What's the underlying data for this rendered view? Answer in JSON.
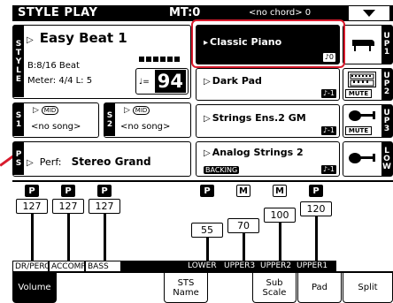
{
  "header": {
    "title": "STYLE PLAY",
    "mt": "MT:0",
    "chord": "<no chord> 0"
  },
  "style": {
    "tab_letters": [
      "S",
      "T",
      "Y",
      "L",
      "E"
    ],
    "name": "Easy Beat 1",
    "beat": "B:8/16 Beat",
    "meter": "Meter:  4/4  L: 5",
    "tempo": "94",
    "tempo_prefix": "♩="
  },
  "songs": [
    {
      "tab": "S1",
      "icon": "MID",
      "value": "<no song>"
    },
    {
      "tab": "S2",
      "icon": "MID",
      "value": "<no song>"
    }
  ],
  "performance": {
    "tab": "PS",
    "label": "Perf:",
    "name": "Stereo Grand"
  },
  "upper_tracks": [
    {
      "name": "Classic Piano",
      "tag": "0",
      "tab": "UP1",
      "icon": "piano-icon",
      "selected": true
    },
    {
      "name": "Dark Pad",
      "tag": "-1",
      "tab": "UP2",
      "icon": "synth-icon",
      "mute": "MUTE"
    },
    {
      "name": "Strings Ens.2 GM",
      "tag": "-1",
      "tab": "UP3",
      "icon": "strings-icon",
      "mute": "MUTE"
    },
    {
      "name": "Analog Strings 2",
      "tag": "-1",
      "tab": "LOW",
      "icon": "strings-icon",
      "extra": "BACKING"
    }
  ],
  "mixer": {
    "channels": [
      {
        "mode": "P",
        "volume": "127",
        "label": "DR/PERC"
      },
      {
        "mode": "P",
        "volume": "127",
        "label": "ACCOMP"
      },
      {
        "mode": "P",
        "volume": "127",
        "label": "BASS"
      },
      {
        "mode": "P",
        "volume": "55",
        "label": "LOWER"
      },
      {
        "mode": "M",
        "volume": "70",
        "label": "UPPER3"
      },
      {
        "mode": "M",
        "volume": "100",
        "label": "UPPER2"
      },
      {
        "mode": "P",
        "volume": "120",
        "label": "UPPER1"
      }
    ],
    "levels": [
      1.0,
      1.0,
      1.0,
      0.43,
      0.55,
      0.79,
      0.94
    ]
  },
  "tabs": [
    {
      "label": "Volume",
      "active": true
    },
    {
      "label": "STS\nName"
    },
    {
      "label": "Sub\nScale"
    },
    {
      "label": "Pad"
    },
    {
      "label": "Split"
    }
  ],
  "colors": {
    "highlight": "#d81b2d",
    "ink": "#000000",
    "paper": "#ffffff"
  }
}
